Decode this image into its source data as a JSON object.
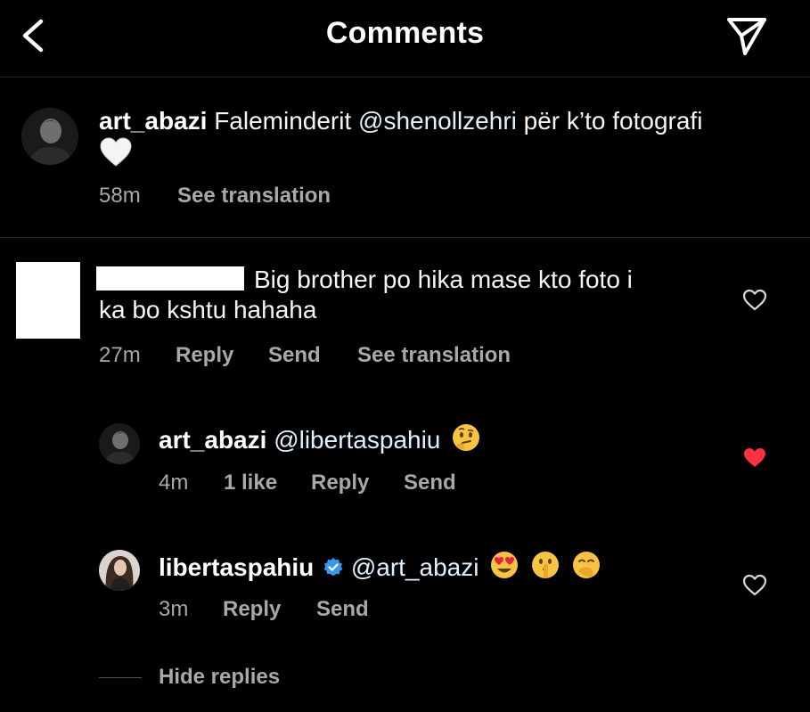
{
  "header": {
    "title": "Comments"
  },
  "caption": {
    "username": "art_abazi",
    "text": "Faleminderit",
    "mention": "@shenollzehri",
    "text_after": "për k’to fotografi",
    "time": "58m",
    "see_translation": "See translation"
  },
  "comment": {
    "text_line1": "Big brother po hika mase kto foto i",
    "text_line2": "ka bo kshtu hahaha",
    "time": "27m",
    "reply": "Reply",
    "send": "Send",
    "see_translation": "See translation"
  },
  "replies": [
    {
      "username": "art_abazi",
      "mention": "@libertaspahiu",
      "time": "4m",
      "likes": "1 like",
      "reply": "Reply",
      "send": "Send",
      "liked": true
    },
    {
      "username": "libertaspahiu",
      "mention": "@art_abazi",
      "time": "3m",
      "reply": "Reply",
      "send": "Send",
      "liked": false
    }
  ],
  "hide_replies": "Hide replies",
  "colors": {
    "background": "#000000",
    "meta": "#a8a8a8",
    "liked_heart": "#ff3040",
    "verified": "#3897f0"
  }
}
